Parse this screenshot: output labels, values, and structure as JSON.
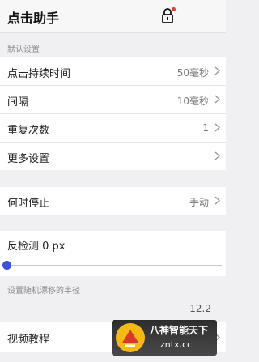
{
  "header": {
    "title": "点击助手",
    "lock_icon": "lock-icon"
  },
  "sections": {
    "default_label": "默认设置",
    "drift_label": "设置随机漂移的半径"
  },
  "settings": {
    "click_duration": {
      "label": "点击持续时间",
      "value": "50毫秒"
    },
    "interval": {
      "label": "间隔",
      "value": "10毫秒"
    },
    "repeat": {
      "label": "重复次数",
      "value": "1"
    },
    "more": {
      "label": "更多设置"
    }
  },
  "stop": {
    "label": "何时停止",
    "value": "手动"
  },
  "anti_detect": {
    "label": "反检测 0 px",
    "level": 0
  },
  "drift": {
    "value": "12.2"
  },
  "video": {
    "label": "视频教程"
  },
  "watermark": {
    "line1": "八神智能天下",
    "line2": "zntx.cc"
  },
  "colors": {
    "accent": "#3f51d6",
    "badge": "#e53935",
    "background": "#f0f0f2"
  }
}
